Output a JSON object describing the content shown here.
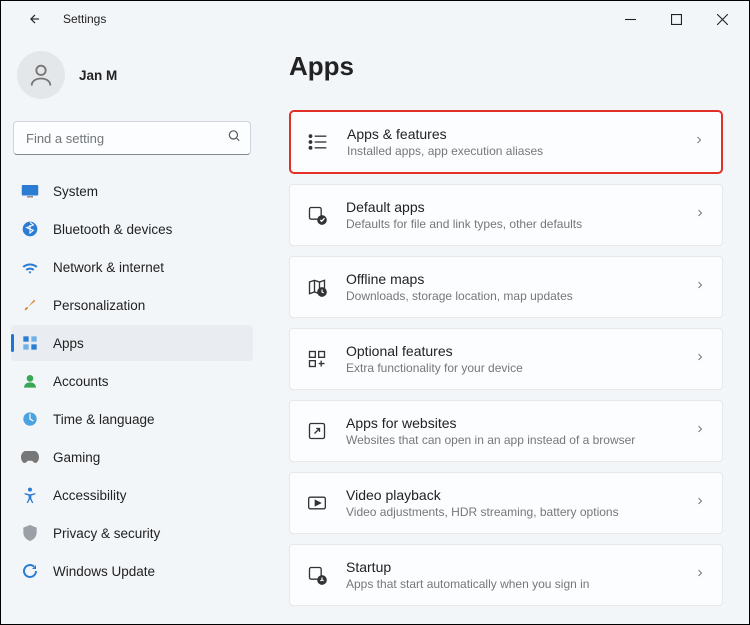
{
  "titlebar": {
    "app_title": "Settings"
  },
  "account": {
    "name": "Jan M"
  },
  "search": {
    "placeholder": "Find a setting"
  },
  "nav": [
    {
      "label": "System"
    },
    {
      "label": "Bluetooth & devices"
    },
    {
      "label": "Network & internet"
    },
    {
      "label": "Personalization"
    },
    {
      "label": "Apps"
    },
    {
      "label": "Accounts"
    },
    {
      "label": "Time & language"
    },
    {
      "label": "Gaming"
    },
    {
      "label": "Accessibility"
    },
    {
      "label": "Privacy & security"
    },
    {
      "label": "Windows Update"
    }
  ],
  "main": {
    "title": "Apps",
    "items": [
      {
        "title": "Apps & features",
        "sub": "Installed apps, app execution aliases"
      },
      {
        "title": "Default apps",
        "sub": "Defaults for file and link types, other defaults"
      },
      {
        "title": "Offline maps",
        "sub": "Downloads, storage location, map updates"
      },
      {
        "title": "Optional features",
        "sub": "Extra functionality for your device"
      },
      {
        "title": "Apps for websites",
        "sub": "Websites that can open in an app instead of a browser"
      },
      {
        "title": "Video playback",
        "sub": "Video adjustments, HDR streaming, battery options"
      },
      {
        "title": "Startup",
        "sub": "Apps that start automatically when you sign in"
      }
    ]
  },
  "colors": {
    "accent": "#1976d2",
    "highlight": "#e33027"
  }
}
